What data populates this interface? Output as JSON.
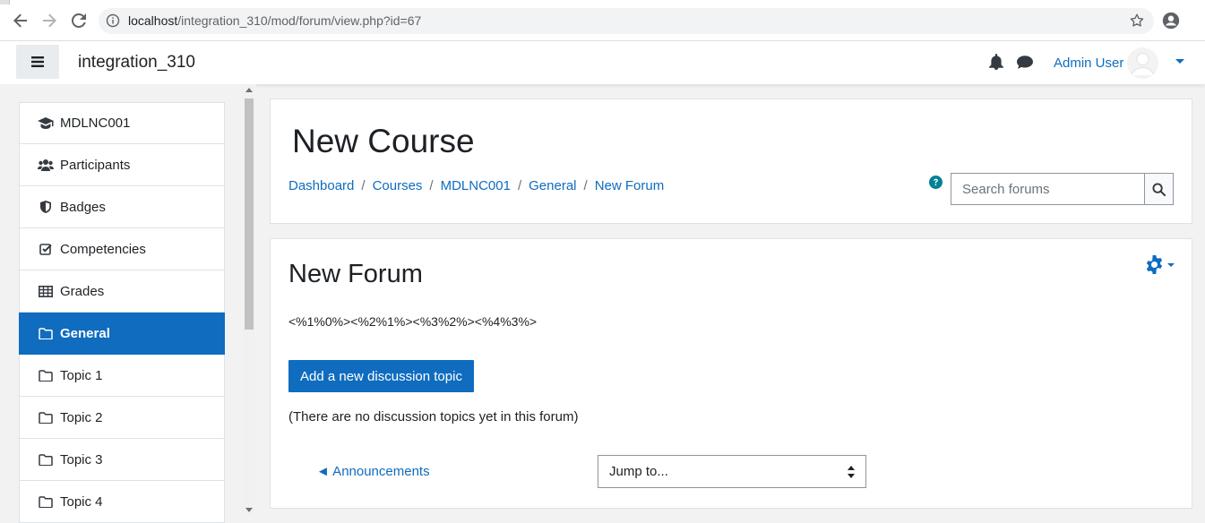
{
  "browser": {
    "url_host": "localhost",
    "url_path": "/integration_310/mod/forum/view.php?id=67"
  },
  "navbar": {
    "site_name": "integration_310",
    "user_name": "Admin User"
  },
  "drawer": {
    "items": [
      {
        "label": "MDLNC001",
        "icon": "graduation-cap-icon"
      },
      {
        "label": "Participants",
        "icon": "users-icon"
      },
      {
        "label": "Badges",
        "icon": "shield-icon"
      },
      {
        "label": "Competencies",
        "icon": "check-square-icon"
      },
      {
        "label": "Grades",
        "icon": "table-icon"
      },
      {
        "label": "General",
        "icon": "folder-icon",
        "active": true
      },
      {
        "label": "Topic 1",
        "icon": "folder-icon"
      },
      {
        "label": "Topic 2",
        "icon": "folder-icon"
      },
      {
        "label": "Topic 3",
        "icon": "folder-icon"
      },
      {
        "label": "Topic 4",
        "icon": "folder-icon"
      }
    ]
  },
  "header": {
    "course_title": "New Course",
    "breadcrumb": [
      "Dashboard",
      "Courses",
      "MDLNC001",
      "General",
      "New Forum"
    ],
    "breadcrumb_sep": "/",
    "search_placeholder": "Search forums"
  },
  "forum": {
    "title": "New Forum",
    "intro": "<%1%0%><%2%1%><%3%2%><%4%3%>",
    "add_button": "Add a new discussion topic",
    "no_topics": "(There are no discussion topics yet in this forum)",
    "prev_activity": "◄ Announcements",
    "jump_to": "Jump to..."
  },
  "colors": {
    "brand": "#0f6cbf",
    "help": "#008196"
  }
}
